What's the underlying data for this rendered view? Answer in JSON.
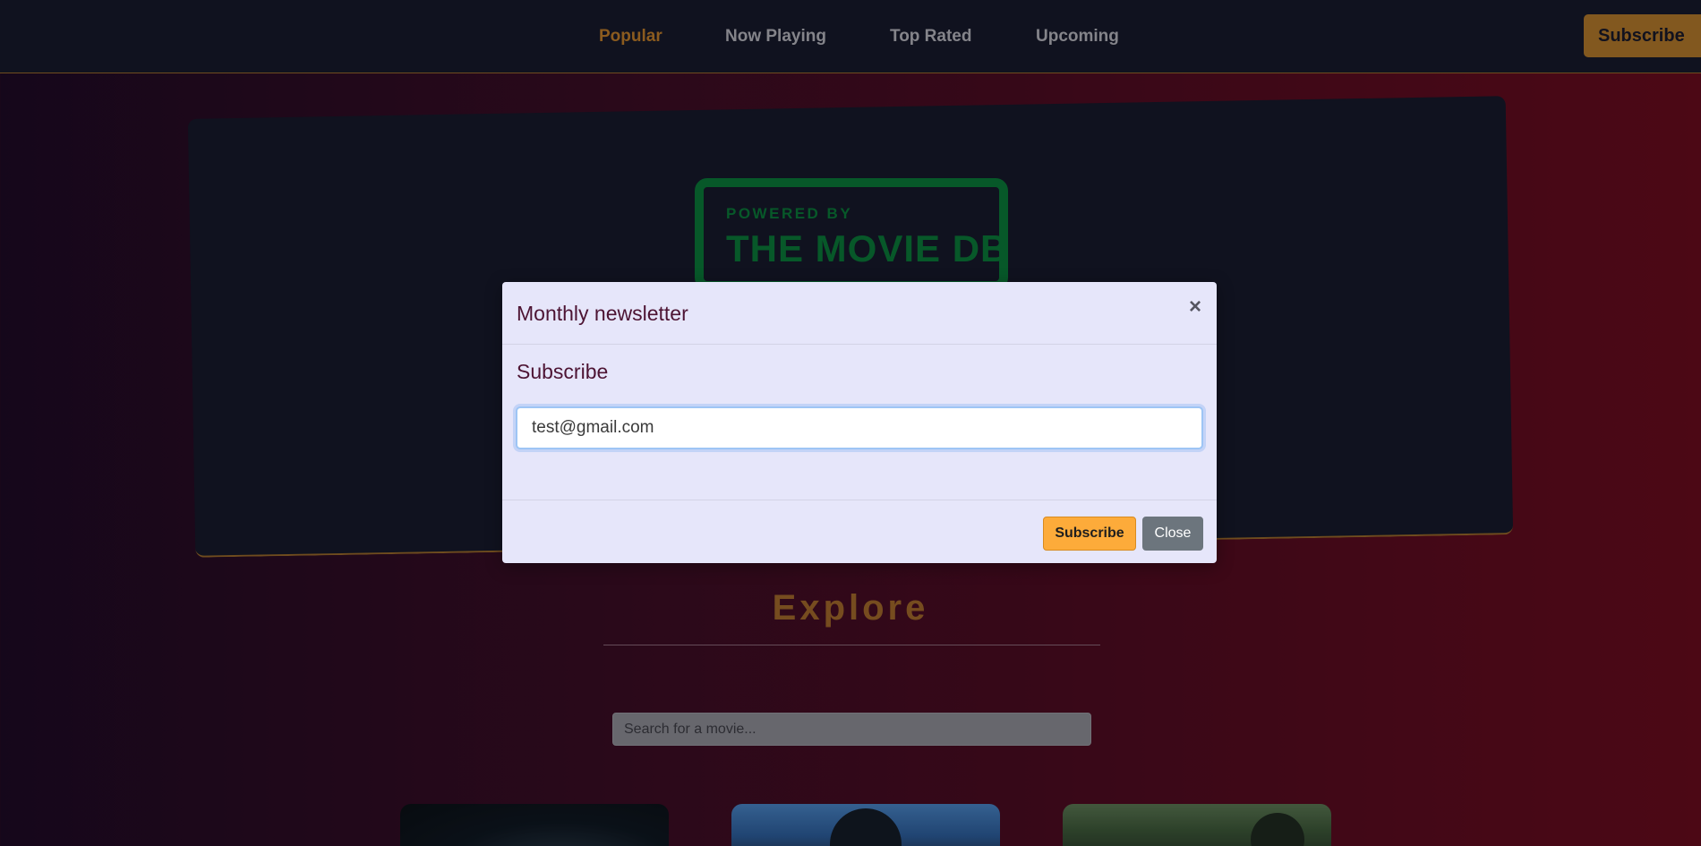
{
  "nav": {
    "links": [
      {
        "label": "Popular",
        "active": true
      },
      {
        "label": "Now Playing",
        "active": false
      },
      {
        "label": "Top Rated",
        "active": false
      },
      {
        "label": "Upcoming",
        "active": false
      }
    ],
    "subscribe_label": "Subscribe"
  },
  "hero": {
    "logo_powered": "POWERED BY",
    "logo_name": "THE MOVIE DB"
  },
  "explore": {
    "title": "Explore",
    "search_placeholder": "Search for a movie..."
  },
  "modal": {
    "title": "Monthly newsletter",
    "close_symbol": "×",
    "subheading": "Subscribe",
    "email_value": "test@gmail.com",
    "subscribe_label": "Subscribe",
    "close_label": "Close"
  },
  "colors": {
    "accent": "#c17f2b",
    "navbar_bg": "#171a2b",
    "modal_bg": "#e6e6fa",
    "subscribe_button": "#fdab3a",
    "close_button": "#6c757d",
    "logo_green": "#0a7a3a"
  }
}
